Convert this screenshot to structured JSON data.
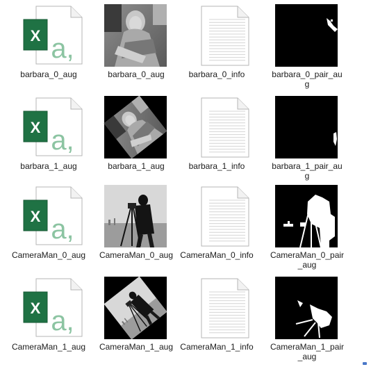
{
  "files": [
    {
      "label": "barbara_0_aug",
      "kind": "xlsx",
      "icon": "excel-file-icon"
    },
    {
      "label": "barbara_0_aug",
      "kind": "photo-barbara",
      "icon": "image-thumbnail"
    },
    {
      "label": "barbara_0_info",
      "kind": "text",
      "icon": "text-file-icon"
    },
    {
      "label": "barbara_0_pair_aug",
      "kind": "mask-barbara-0",
      "icon": "mask-image-thumbnail"
    },
    {
      "label": "barbara_1_aug",
      "kind": "xlsx",
      "icon": "excel-file-icon"
    },
    {
      "label": "barbara_1_aug",
      "kind": "photo-barbara-rot",
      "icon": "image-thumbnail"
    },
    {
      "label": "barbara_1_info",
      "kind": "text",
      "icon": "text-file-icon"
    },
    {
      "label": "barbara_1_pair_aug",
      "kind": "mask-barbara-1",
      "icon": "mask-image-thumbnail"
    },
    {
      "label": "CameraMan_0_aug",
      "kind": "xlsx",
      "icon": "excel-file-icon"
    },
    {
      "label": "CameraMan_0_aug",
      "kind": "photo-cameraman",
      "icon": "image-thumbnail"
    },
    {
      "label": "CameraMan_0_info",
      "kind": "text",
      "icon": "text-file-icon"
    },
    {
      "label": "CameraMan_0_pair_aug",
      "kind": "mask-cameraman-0",
      "icon": "mask-image-thumbnail"
    },
    {
      "label": "CameraMan_1_aug",
      "kind": "xlsx",
      "icon": "excel-file-icon"
    },
    {
      "label": "CameraMan_1_aug",
      "kind": "photo-cameraman-rot",
      "icon": "image-thumbnail"
    },
    {
      "label": "CameraMan_1_info",
      "kind": "text",
      "icon": "text-file-icon"
    },
    {
      "label": "CameraMan_1_pair_aug",
      "kind": "mask-cameraman-1",
      "icon": "mask-image-thumbnail"
    }
  ],
  "colors": {
    "excel_green": "#1f7244",
    "excel_accent": "#8cc4a2",
    "page_fill": "#ffffff",
    "page_border": "#b6b6b6",
    "text_lines": "#d4d4d4"
  }
}
